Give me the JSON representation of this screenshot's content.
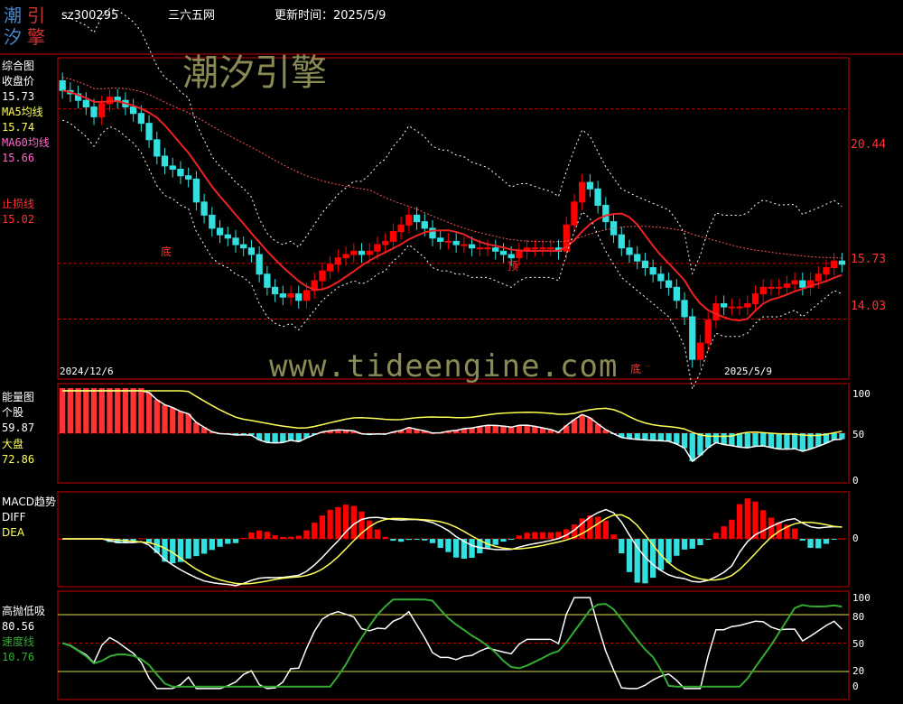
{
  "header": {
    "logo_chars": [
      "潮",
      "引",
      "汐",
      "擎"
    ],
    "stock_code": "sz300295",
    "source": "三六五网",
    "update_label": "更新时间：2025/5/9"
  },
  "watermark": {
    "cn": "潮汐引擎",
    "url": "www.tideengine.com"
  },
  "colors": {
    "bg": "#000000",
    "frame": "#cc0000",
    "up": "#ff0000",
    "down": "#33e0e0",
    "ma5": "#ffff55",
    "ma60": "#ff66cc",
    "stop": "#ff3333",
    "speed": "#33aa33",
    "dea": "#ffff55"
  },
  "panels": {
    "main": {
      "title": "综合图",
      "close_label": "收盘价",
      "close_value": "15.73",
      "ma5_label": "MA5均线",
      "ma5_value": "15.74",
      "ma60_label": "MA60均线",
      "ma60_value": "15.66",
      "stop_label": "止损线",
      "stop_value": "15.02",
      "axis": [
        "20.44",
        "15.73",
        "14.03"
      ],
      "date_start": "2024/12/6",
      "date_end": "2025/5/9",
      "bottom_marks": [
        "底",
        "顶",
        "底"
      ]
    },
    "energy": {
      "title": "能量图",
      "stock_label": "个股",
      "stock_value": "59.87",
      "market_label": "大盘",
      "market_value": "72.86",
      "axis": [
        "100",
        "50",
        "0"
      ]
    },
    "macd": {
      "title": "MACD趋势",
      "diff_label": "DIFF",
      "dea_label": "DEA",
      "axis": [
        "0"
      ]
    },
    "tide": {
      "title": "高抛低吸",
      "value": "80.56",
      "speed_label": "速度线",
      "speed_value": "10.76",
      "axis": [
        "100",
        "80",
        "50",
        "20",
        "0"
      ]
    }
  },
  "chart_data": {
    "type": "candlestick",
    "n_bars": 100,
    "price_range": [
      12.2,
      22.0
    ],
    "closes": [
      21.0,
      20.9,
      20.7,
      20.5,
      20.2,
      20.6,
      20.8,
      20.7,
      20.5,
      20.3,
      20.0,
      19.5,
      19.0,
      18.7,
      18.6,
      18.4,
      18.3,
      17.6,
      17.2,
      16.8,
      16.6,
      16.5,
      16.3,
      16.2,
      16.0,
      15.4,
      15.0,
      14.8,
      14.7,
      14.8,
      14.6,
      14.9,
      15.2,
      15.5,
      15.7,
      15.9,
      16.0,
      16.1,
      16.0,
      16.1,
      16.3,
      16.4,
      16.7,
      16.9,
      17.2,
      17.0,
      16.8,
      16.5,
      16.4,
      16.4,
      16.3,
      16.3,
      16.2,
      16.2,
      16.2,
      16.1,
      16.0,
      15.9,
      16.1,
      16.2,
      16.2,
      16.2,
      16.2,
      16.1,
      16.9,
      17.6,
      18.2,
      18.0,
      17.5,
      17.0,
      16.6,
      16.2,
      16.0,
      15.8,
      15.6,
      15.4,
      15.2,
      15.0,
      14.6,
      14.1,
      12.8,
      13.3,
      14.0,
      14.5,
      14.4,
      14.4,
      14.4,
      14.5,
      14.8,
      15.0,
      15.0,
      15.0,
      15.1,
      15.2,
      15.0,
      15.2,
      15.4,
      15.6,
      15.8,
      15.7
    ]
  }
}
